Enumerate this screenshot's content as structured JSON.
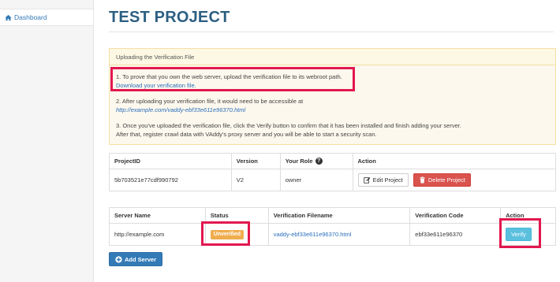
{
  "sidebar": {
    "items": [
      {
        "label": "Dashboard",
        "icon": "home-icon"
      }
    ]
  },
  "page": {
    "title": "TEST PROJECT"
  },
  "verification_panel": {
    "heading": "Uploading the Verification File",
    "step1_text": "1. To prove that you own the web server, upload the verification file to its webroot path.",
    "step1_link": "Download your verification file.",
    "step2_text": "2. After uploading your verification file, it would need to be accessible at",
    "step2_url": "http://example.com/vaddy-ebf33e611e96370.html",
    "step3_line1": "3. Once you've uploaded the verification file, click the Verify button to confirm that it has been installed and finish adding your server.",
    "step3_line2": "After that, register crawl data with VAddy's proxy server and you will be able to start a security scan."
  },
  "project_table": {
    "headers": [
      "ProjectID",
      "Version",
      "Your Role",
      "Action"
    ],
    "help_icon": "?",
    "row": {
      "project_id": "5b703521e77cdf990792",
      "version": "V2",
      "role": "owner",
      "edit_label": "Edit Project",
      "delete_label": "Delete Project"
    }
  },
  "server_table": {
    "headers": [
      "Server Name",
      "Status",
      "Verification Filename",
      "Verification Code",
      "Action"
    ],
    "row": {
      "server_name": "http://example.com",
      "status": "Unverified",
      "filename": "vaddy-ebf33e611e96370.html",
      "code": "ebf33e611e96370",
      "verify_label": "Verify"
    }
  },
  "add_server_label": "Add Server",
  "colors": {
    "title": "#2c5f82",
    "link": "#2a6ebb",
    "warning": "#f0ad4e",
    "danger": "#d9534f",
    "info": "#5bc0de",
    "primary": "#337ab7",
    "highlight": "#e2174e"
  }
}
